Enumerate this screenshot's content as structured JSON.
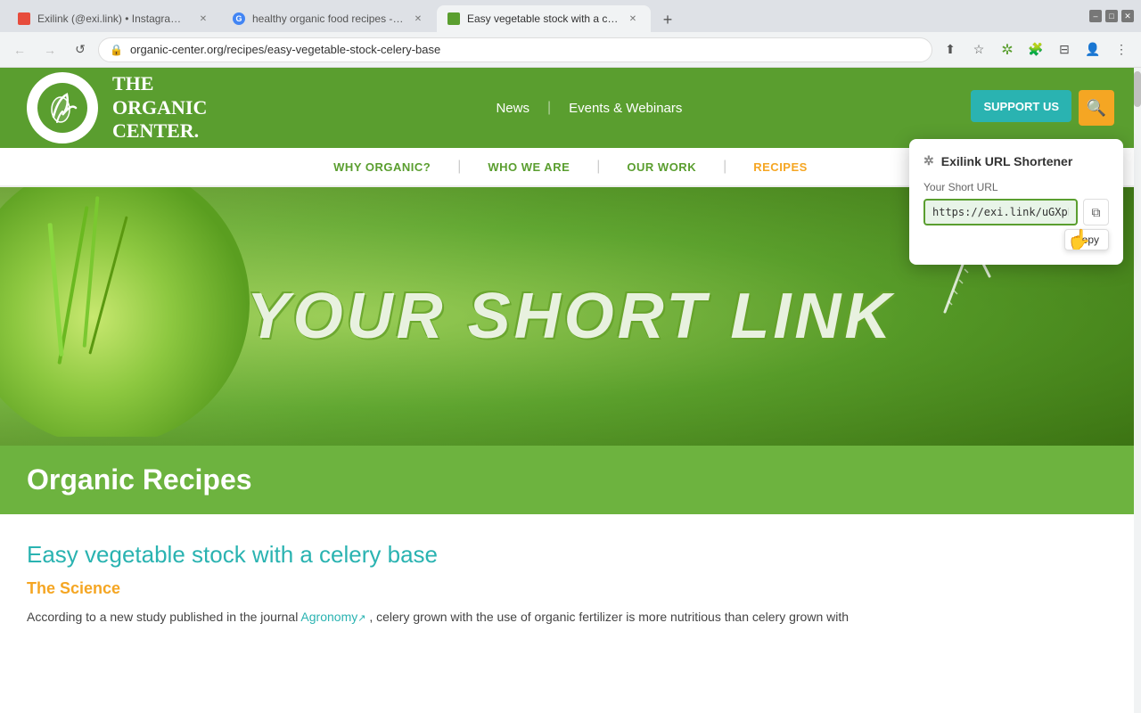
{
  "browser": {
    "tabs": [
      {
        "id": "tab1",
        "favicon_color": "#e74c3c",
        "title": "Exilink (@exi.link) • Instagram ph...",
        "active": false
      },
      {
        "id": "tab2",
        "favicon_color": "#4285f4",
        "title": "healthy organic food recipes - G...",
        "active": false
      },
      {
        "id": "tab3",
        "favicon_color": "#5a9e2f",
        "title": "Easy vegetable stock with a cele...",
        "active": true
      }
    ],
    "url": "organic-center.org/recipes/easy-vegetable-stock-celery-base",
    "new_tab_label": "+",
    "nav": {
      "back_icon": "←",
      "forward_icon": "→",
      "reload_icon": "↺",
      "home_icon": "⌂"
    },
    "toolbar": {
      "share_icon": "⬆",
      "star_icon": "☆",
      "extension_icon": "🧩",
      "puzzle_icon": "⊞",
      "sidebar_icon": "⊟",
      "profile_icon": "👤",
      "menu_icon": "⋮"
    },
    "window_controls": {
      "minimize": "–",
      "maximize": "□",
      "close": "✕"
    }
  },
  "site": {
    "logo": {
      "alt": "The Organic Center Logo"
    },
    "brand_name_line1": "THE",
    "brand_name_line2": "ORGANIC",
    "brand_name_line3": "CENTER.",
    "nav": {
      "items": [
        "News",
        "Events & Webinars"
      ],
      "separator": "|"
    },
    "header_buttons": {
      "support": "SUPPORT US",
      "search_icon": "🔍"
    },
    "sub_nav": {
      "items": [
        "WHY ORGANIC?",
        "WHO WE ARE",
        "OUR WORK",
        "RECIPES"
      ],
      "separator": "|"
    }
  },
  "hero": {
    "text": "YOUR SHORT LINK"
  },
  "green_banner": {
    "title": "Organic Recipes"
  },
  "article": {
    "title": "Easy vegetable stock with a celery base",
    "section_label": "The Science",
    "body_text": "According to a new study published in the journal ",
    "link_text": "Agronomy",
    "body_text2": ", celery grown with the use of organic fertilizer is more nutritious than celery grown with"
  },
  "popup": {
    "header_icon": "✲",
    "title": "Exilink URL Shortener",
    "url_label": "Your Short URL",
    "short_url": "https://exi.link/uGXpPR",
    "copy_icon": "⧉",
    "copy_tooltip": "Copy",
    "cursor": "☛"
  }
}
